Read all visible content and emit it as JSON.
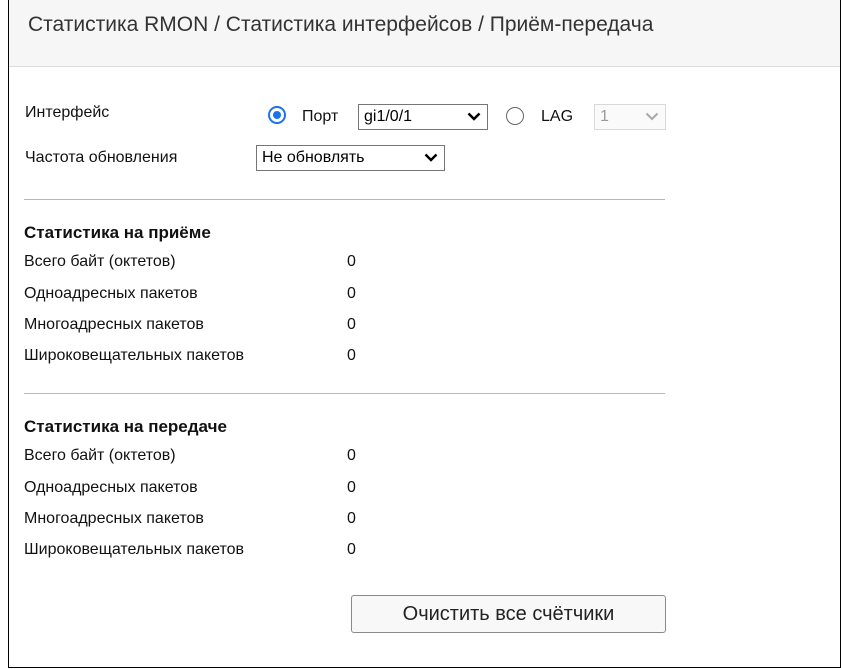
{
  "header": {
    "breadcrumb": "Статистика RMON / Статистика интерфейсов / Приём-передача"
  },
  "form": {
    "interface_label": "Интерфейс",
    "port_option_label": "Порт",
    "port_selected": true,
    "port_value": "gi1/0/1",
    "lag_option_label": "LAG",
    "lag_value": "1",
    "refresh_label": "Частота обновления",
    "refresh_value": "Не обновлять"
  },
  "rx": {
    "title": "Статистика на приёме",
    "rows": [
      {
        "label": "Всего байт (октетов)",
        "value": "0"
      },
      {
        "label": "Одноадресных пакетов",
        "value": "0"
      },
      {
        "label": "Многоадресных пакетов",
        "value": "0"
      },
      {
        "label": "Широковещательных пакетов",
        "value": "0"
      }
    ]
  },
  "tx": {
    "title": "Статистика на передаче",
    "rows": [
      {
        "label": "Всего байт (октетов)",
        "value": "0"
      },
      {
        "label": "Одноадресных пакетов",
        "value": "0"
      },
      {
        "label": "Многоадресных пакетов",
        "value": "0"
      },
      {
        "label": "Широковещательных пакетов",
        "value": "0"
      }
    ]
  },
  "actions": {
    "clear_all_label": "Очистить все счётчики"
  },
  "colors": {
    "radio_accent": "#1a73e8",
    "header_bg": "#f6f6f6"
  }
}
